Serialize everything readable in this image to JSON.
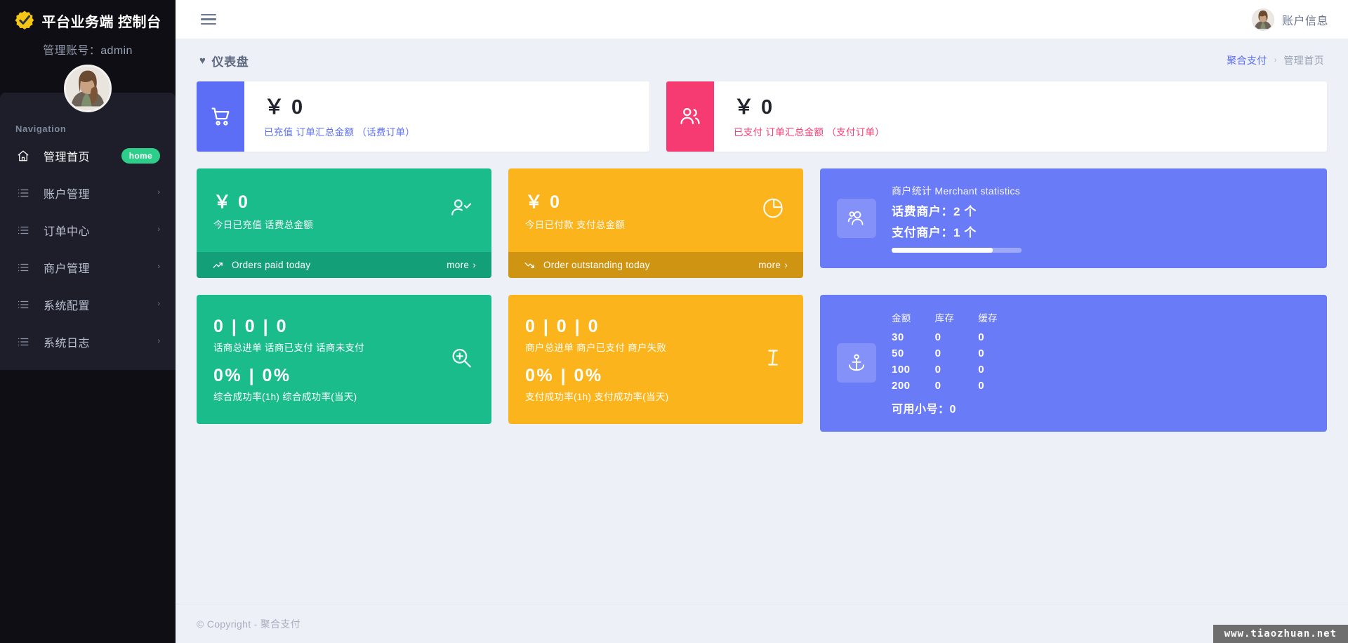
{
  "sidebar": {
    "brand_name": "平台业务端 控制台",
    "brand_logo_icon": "gear-check-icon",
    "admin_label": "管理账号：",
    "admin_user": "admin",
    "avatar_icon": "user-avatar",
    "nav_title": "Navigation",
    "items": [
      {
        "label": "管理首页",
        "icon": "home-icon",
        "badge": "home",
        "chevron": "",
        "active": true
      },
      {
        "label": "账户管理",
        "icon": "list-icon",
        "badge": "",
        "chevron": "›",
        "active": false
      },
      {
        "label": "订单中心",
        "icon": "list-icon",
        "badge": "",
        "chevron": "›",
        "active": false
      },
      {
        "label": "商户管理",
        "icon": "list-icon",
        "badge": "",
        "chevron": "›",
        "active": false
      },
      {
        "label": "系统配置",
        "icon": "list-icon",
        "badge": "",
        "chevron": "›",
        "active": false
      },
      {
        "label": "系统日志",
        "icon": "list-icon",
        "badge": "",
        "chevron": "›",
        "active": false
      }
    ]
  },
  "topbar": {
    "menu_icon": "hamburger-icon",
    "account_label": "账户信息",
    "account_avatar_icon": "user-avatar"
  },
  "page": {
    "heart_icon": "heart-icon",
    "title": "仪表盘",
    "breadcrumb_link": "聚合支付",
    "breadcrumb_sep": "›",
    "breadcrumb_current": "管理首页"
  },
  "summary_cards": [
    {
      "icon": "shopping-cart-icon",
      "icon_color": "#5b6ef5",
      "value": "￥ 0",
      "subtitle": "已充值 订单汇总金额 （话费订单）"
    },
    {
      "icon": "users-icon",
      "icon_color": "#f63b72",
      "value": "￥ 0",
      "subtitle": "已支付 订单汇总金额 （支付订单）"
    }
  ],
  "tiles_row2": [
    {
      "color": "#1abc8c",
      "value": "￥ 0",
      "subtitle": "今日已充值 话费总金额",
      "big_icon": "user-check-icon",
      "foot_icon": "trend-up-icon",
      "foot_label": "Orders paid today",
      "more_label": "more",
      "more_chevron": "›"
    },
    {
      "color": "#fbb41c",
      "value": "￥ 0",
      "subtitle": "今日已付款 支付总金额",
      "big_icon": "pie-chart-icon",
      "foot_icon": "trend-down-icon",
      "foot_label": "Order outstanding today",
      "more_label": "more",
      "more_chevron": "›"
    }
  ],
  "merchant_card": {
    "color": "#6a7bf7",
    "icon": "users-group-icon",
    "title": "商户统计 Merchant statistics",
    "line1": "话费商户：2 个",
    "line2": "支付商户：1 个",
    "progress_percent": 78
  },
  "tiles_row3": [
    {
      "color": "#1abc8c",
      "counts": "0 | 0 | 0",
      "count_labels": "话商总进单  话商已支付  话商未支付",
      "rates": "0% | 0%",
      "rate_labels": "综合成功率(1h)  综合成功率(当天)",
      "big_icon": "zoom-in-icon"
    },
    {
      "color": "#fbb41c",
      "counts": "0 | 0 | 0",
      "count_labels": "商户总进单  商户已支付  商户失败",
      "rates": "0% | 0%",
      "rate_labels": "支付成功率(1h)  支付成功率(当天)",
      "big_icon": "text-cursor-icon"
    }
  ],
  "stock_card": {
    "color": "#6a7bf7",
    "icon": "anchor-icon",
    "headers": [
      "金额",
      "库存",
      "缓存"
    ],
    "rows": [
      [
        "30",
        "0",
        "0"
      ],
      [
        "50",
        "0",
        "0"
      ],
      [
        "100",
        "0",
        "0"
      ],
      [
        "200",
        "0",
        "0"
      ]
    ],
    "footer": "可用小号：0"
  },
  "footer": {
    "copyright": "© Copyright - 聚合支付",
    "watermark": "www.tiaozhuan.net"
  }
}
